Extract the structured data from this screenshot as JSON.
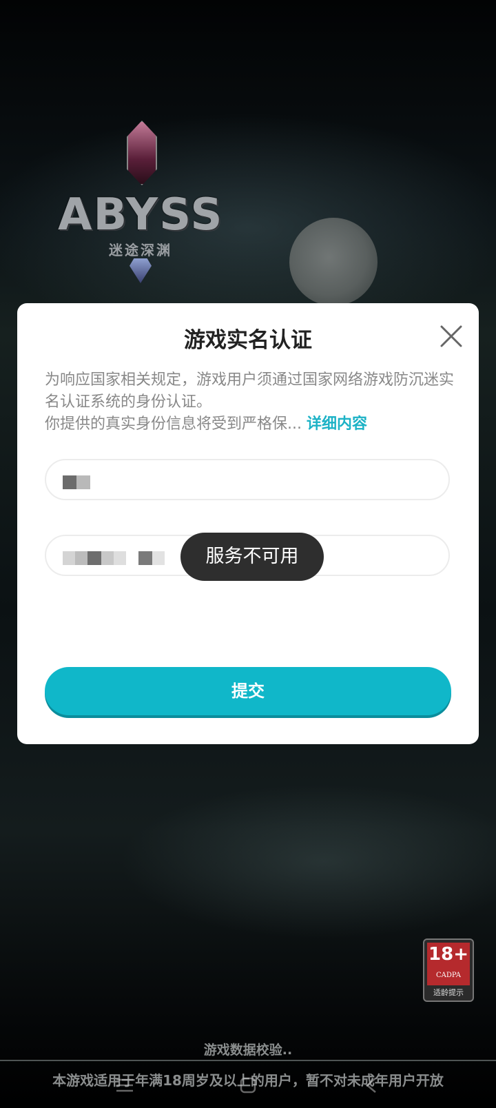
{
  "game": {
    "logo_title": "ABYSS",
    "logo_subtitle": "迷途深渊"
  },
  "dialog": {
    "title": "游戏实名认证",
    "notice_line1": "为响应国家相关规定，游戏用户须通过国家网络游戏防沉迷实名认证系统的身份认证。",
    "notice_line2": "你提供的真实身份信息将受到严格保...",
    "detail_link": "详细内容",
    "submit_label": "提交"
  },
  "toast": {
    "message": "服务不可用"
  },
  "age_rating": {
    "number": "18+",
    "org": "CADPA",
    "caption": "适龄提示"
  },
  "status": {
    "loading_text": "游戏数据校验..",
    "footer_notice": "本游戏适用于年满18周岁及以上的用户，暂不对未成年用户开放"
  },
  "icons": {
    "close": "close-icon",
    "menu": "menu-icon",
    "home": "home-icon",
    "back": "back-icon"
  },
  "colors": {
    "accent": "#10b7c9",
    "link": "#1cb2c6",
    "badge_red": "#b52a2d"
  }
}
